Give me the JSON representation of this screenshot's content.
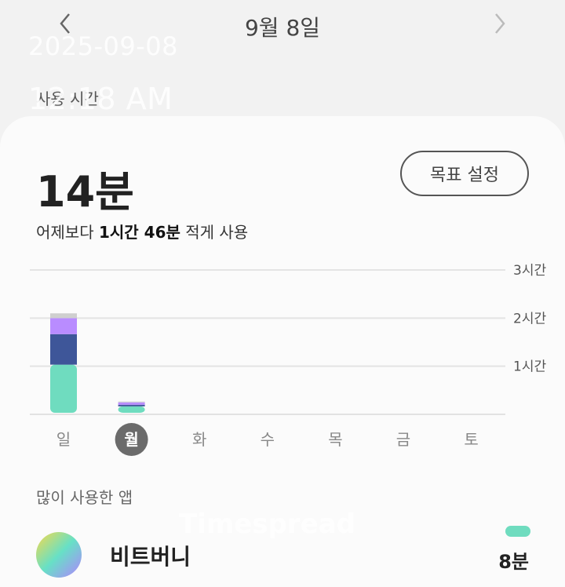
{
  "header": {
    "date": "9월 8일",
    "prev_icon": "chevron-left-icon",
    "next_icon": "chevron-right-icon"
  },
  "overlay": {
    "date": "2025-09-08",
    "time": "12:18 AM"
  },
  "section_label": "사용 시간",
  "summary": {
    "total": "14분",
    "goal_button": "목표 설정",
    "compare_prefix": "어제보다 ",
    "compare_value": "1시간 46분",
    "compare_suffix": " 적게 사용"
  },
  "chart_data": {
    "type": "bar",
    "categories": [
      "일",
      "월",
      "화",
      "수",
      "목",
      "금",
      "토"
    ],
    "selected": "월",
    "y_ticks": [
      "1시간",
      "2시간",
      "3시간"
    ],
    "ylim_minutes": [
      0,
      180
    ],
    "series": [
      {
        "color": "#6fdcbf",
        "values": [
          60,
          8,
          0,
          0,
          0,
          0,
          0
        ]
      },
      {
        "color": "#3e5699",
        "values": [
          38,
          2,
          0,
          0,
          0,
          0,
          0
        ]
      },
      {
        "color": "#b98cff",
        "values": [
          20,
          3,
          0,
          0,
          0,
          0,
          0
        ]
      },
      {
        "color": "#cfcfcf",
        "values": [
          6,
          1,
          0,
          0,
          0,
          0,
          0
        ]
      }
    ]
  },
  "apps_section": {
    "label": "많이 사용한 앱",
    "items": [
      {
        "name": "비트버니",
        "time": "8분",
        "bar_color": "#6fdcbf"
      }
    ]
  },
  "watermark": "Timespread"
}
